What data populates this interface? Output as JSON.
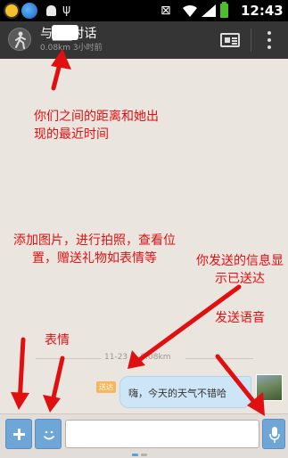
{
  "status_bar": {
    "time": "12:43",
    "icons": [
      "clock-app-icon",
      "browser-globe-icon",
      "android-icon",
      "usb-icon",
      "silent-icon",
      "wifi-icon",
      "signal-icon",
      "battery-icon"
    ]
  },
  "header": {
    "title": "与██对话",
    "subtitle": "0.08km 3小时前",
    "icons": [
      "walking-person-icon",
      "profile-card-icon",
      "more-menu-icon"
    ]
  },
  "annotations": {
    "distance": "你们之间的距离和她出现的最近时间",
    "attach": "添加图片，进行拍照，查看位置，赠送礼物如表情等",
    "sent": "你发送的信息显示已送达",
    "emoji": "表情",
    "voice": "发送语音"
  },
  "chat": {
    "time_divider": "11-23 ... 0.08km",
    "messages": [
      {
        "status": "送达",
        "text": "嗨，今天的天气不错哈",
        "from": "me"
      }
    ]
  },
  "input_bar": {
    "value": "",
    "placeholder": ""
  },
  "colors": {
    "annotation": "#e01010",
    "header_bg": "#363535",
    "chat_bg": "#ebe5df",
    "bubble_bg": "#cde6f7",
    "button_blue": "#6fa6d8",
    "sent_badge": "#f7b65a"
  }
}
